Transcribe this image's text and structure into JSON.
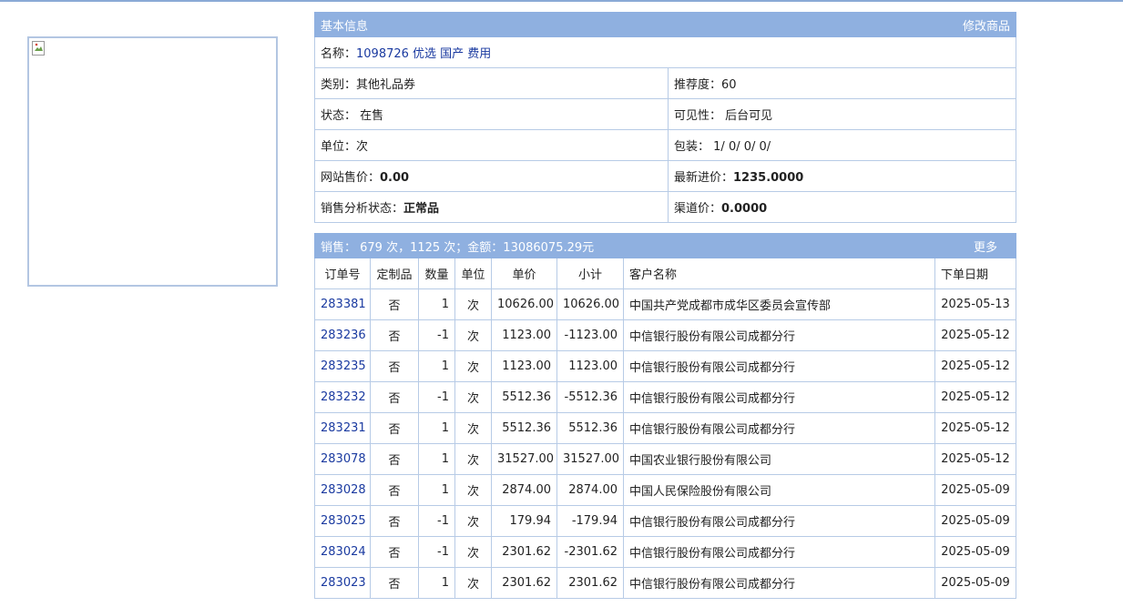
{
  "info": {
    "header_title": "基本信息",
    "edit_link": "修改商品",
    "name_label": "名称：",
    "name_value": "1098726 优选 国产 费用",
    "category_label": "类别：",
    "category_value": "其他礼品券",
    "recommend_label": "推荐度：",
    "recommend_value": "60",
    "status_label": "状态：",
    "status_value": "在售",
    "visibility_label": "可见性：",
    "visibility_value": "后台可见",
    "unit_label": "单位：",
    "unit_value": "次",
    "package_label": "包装：",
    "package_value": "1/ 0/ 0/ 0/",
    "site_price_label": "网站售价：",
    "site_price_value": "0.00",
    "latest_cost_label": "最新进价：",
    "latest_cost_value": "1235.0000",
    "sales_status_label": "销售分析状态：",
    "sales_status_value": "正常品",
    "channel_price_label": "渠道价：",
    "channel_price_value": "0.0000"
  },
  "sales": {
    "summary": "销售：  679 次，1125 次；金额：13086075.29元",
    "more_link": "更多",
    "columns": [
      "订单号",
      "定制品",
      "数量",
      "单位",
      "单价",
      "小计",
      "客户名称",
      "下单日期"
    ],
    "rows": [
      {
        "order": "283381",
        "custom": "否",
        "qty": "1",
        "unit": "次",
        "price": "10626.00",
        "subtotal": "10626.00",
        "customer": "中国共产党成都市成华区委员会宣传部",
        "date": "2025-05-13"
      },
      {
        "order": "283236",
        "custom": "否",
        "qty": "-1",
        "unit": "次",
        "price": "1123.00",
        "subtotal": "-1123.00",
        "customer": "中信银行股份有限公司成都分行",
        "date": "2025-05-12"
      },
      {
        "order": "283235",
        "custom": "否",
        "qty": "1",
        "unit": "次",
        "price": "1123.00",
        "subtotal": "1123.00",
        "customer": "中信银行股份有限公司成都分行",
        "date": "2025-05-12"
      },
      {
        "order": "283232",
        "custom": "否",
        "qty": "-1",
        "unit": "次",
        "price": "5512.36",
        "subtotal": "-5512.36",
        "customer": "中信银行股份有限公司成都分行",
        "date": "2025-05-12"
      },
      {
        "order": "283231",
        "custom": "否",
        "qty": "1",
        "unit": "次",
        "price": "5512.36",
        "subtotal": "5512.36",
        "customer": "中信银行股份有限公司成都分行",
        "date": "2025-05-12"
      },
      {
        "order": "283078",
        "custom": "否",
        "qty": "1",
        "unit": "次",
        "price": "31527.00",
        "subtotal": "31527.00",
        "customer": "中国农业银行股份有限公司",
        "date": "2025-05-12"
      },
      {
        "order": "283028",
        "custom": "否",
        "qty": "1",
        "unit": "次",
        "price": "2874.00",
        "subtotal": "2874.00",
        "customer": "中国人民保险股份有限公司",
        "date": "2025-05-09"
      },
      {
        "order": "283025",
        "custom": "否",
        "qty": "-1",
        "unit": "次",
        "price": "179.94",
        "subtotal": "-179.94",
        "customer": "中信银行股份有限公司成都分行",
        "date": "2025-05-09"
      },
      {
        "order": "283024",
        "custom": "否",
        "qty": "-1",
        "unit": "次",
        "price": "2301.62",
        "subtotal": "-2301.62",
        "customer": "中信银行股份有限公司成都分行",
        "date": "2025-05-09"
      },
      {
        "order": "283023",
        "custom": "否",
        "qty": "1",
        "unit": "次",
        "price": "2301.62",
        "subtotal": "2301.62",
        "customer": "中信银行股份有限公司成都分行",
        "date": "2025-05-09"
      }
    ]
  },
  "colors": {
    "header_bg": "#8fb0e0",
    "border": "#b7cbe6",
    "link": "#1a3aa0"
  }
}
